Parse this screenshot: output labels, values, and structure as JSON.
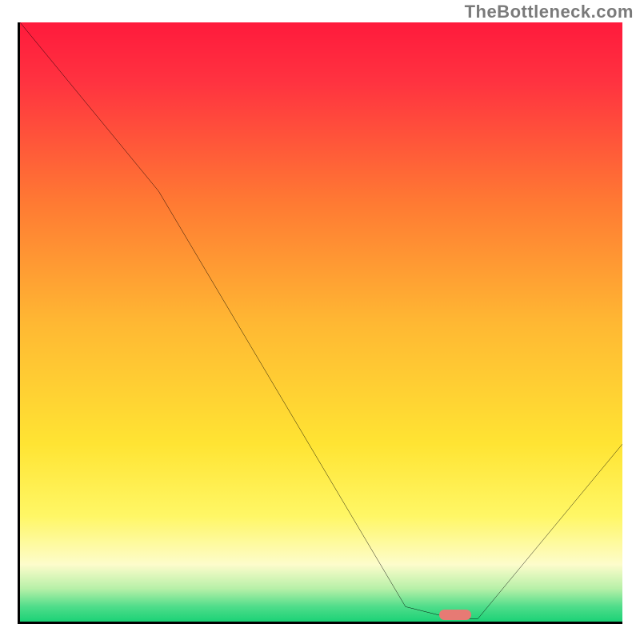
{
  "watermark": "TheBottleneck.com",
  "chart_data": {
    "type": "line",
    "title": "",
    "xlabel": "",
    "ylabel": "",
    "xlim": [
      0,
      100
    ],
    "ylim": [
      0,
      100
    ],
    "grid": false,
    "series": [
      {
        "name": "bottleneck-curve",
        "x": [
          0,
          23,
          64,
          72,
          76,
          100
        ],
        "y": [
          100,
          72,
          3,
          1,
          1,
          30
        ]
      }
    ],
    "marker": {
      "x": 72,
      "y": 1
    },
    "background_gradient": {
      "stops": [
        {
          "offset": 0.0,
          "color": "#ff1a3c"
        },
        {
          "offset": 0.1,
          "color": "#ff3340"
        },
        {
          "offset": 0.3,
          "color": "#ff7a33"
        },
        {
          "offset": 0.5,
          "color": "#ffb833"
        },
        {
          "offset": 0.7,
          "color": "#ffe433"
        },
        {
          "offset": 0.82,
          "color": "#fff766"
        },
        {
          "offset": 0.9,
          "color": "#fdfccb"
        },
        {
          "offset": 0.94,
          "color": "#b7f0a8"
        },
        {
          "offset": 0.97,
          "color": "#4fdd8a"
        },
        {
          "offset": 1.0,
          "color": "#10cf72"
        }
      ]
    }
  }
}
